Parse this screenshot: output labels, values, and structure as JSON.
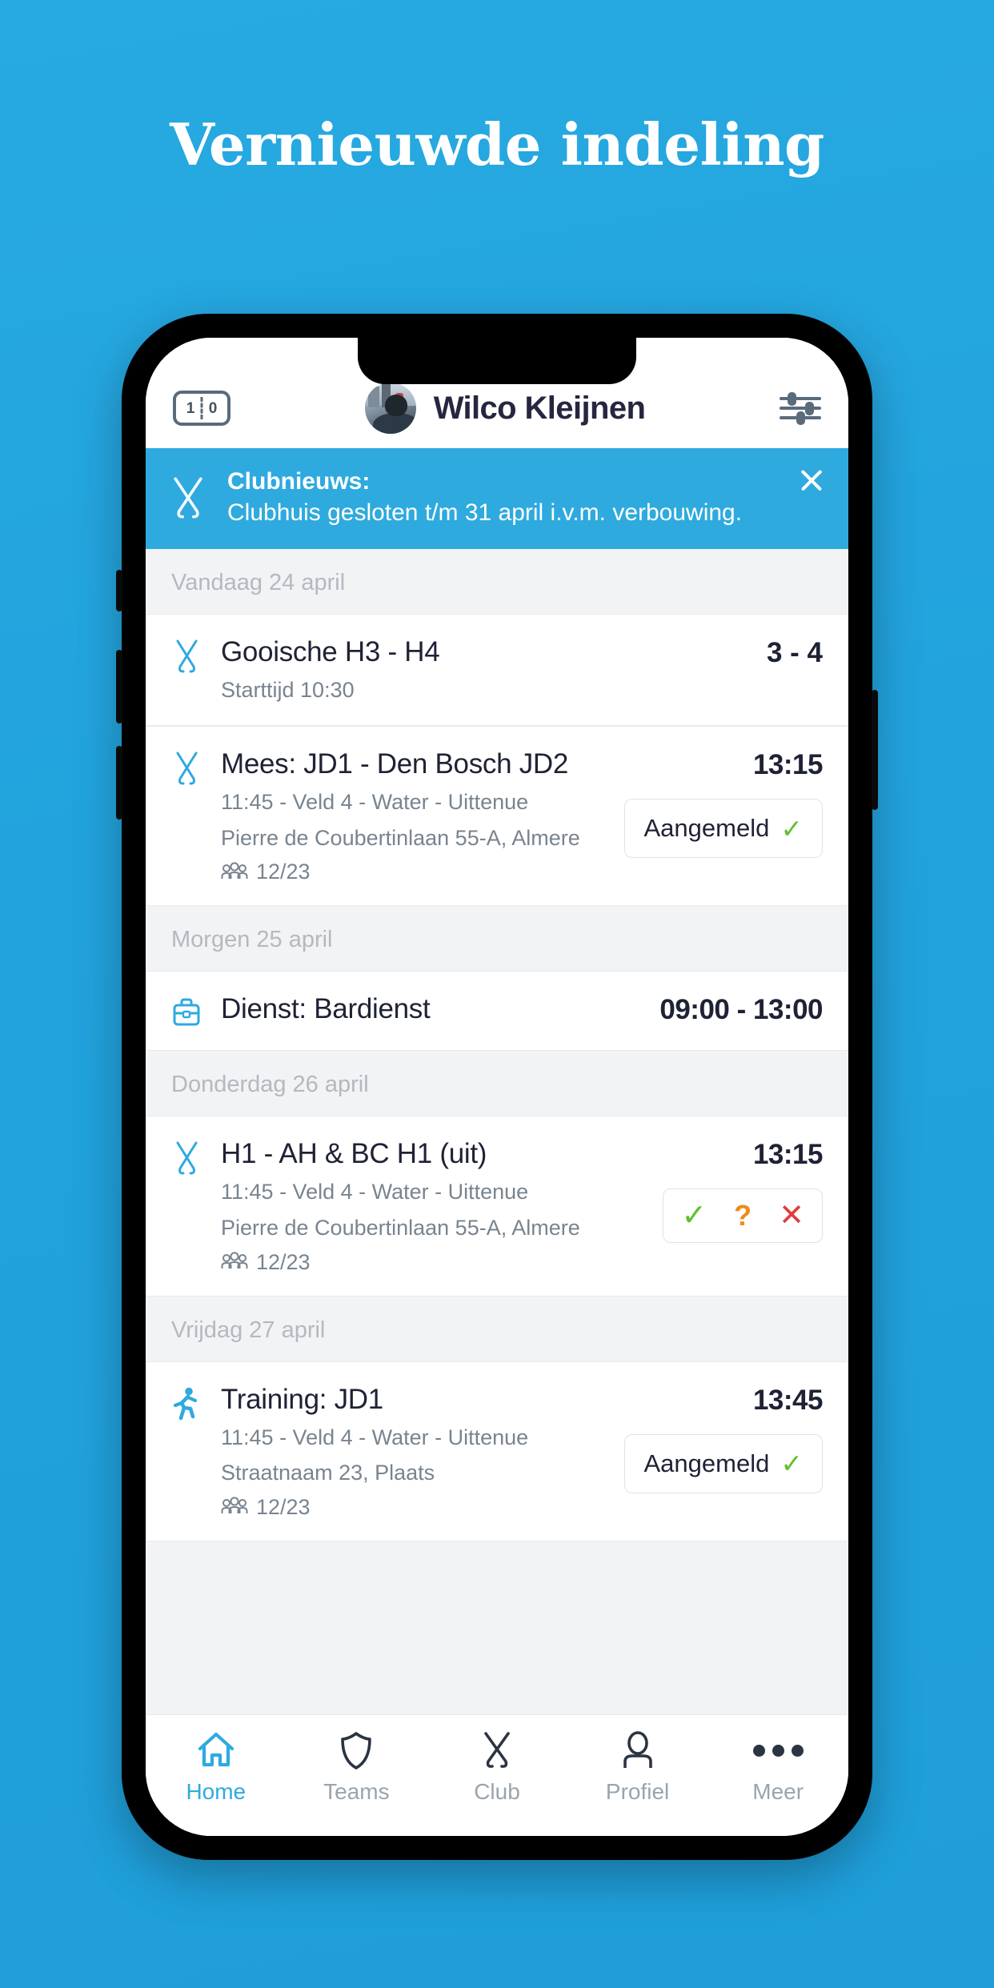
{
  "page": {
    "headline": "Vernieuwde indeling",
    "background_color": "#27a9e1"
  },
  "app_header": {
    "scoreboard_icon": "scoreboard-icon",
    "score_left": "1",
    "score_right": "0",
    "avatar": "user-avatar",
    "user_name": "Wilco Kleijnen",
    "settings_icon": "sliders-icon"
  },
  "banner": {
    "icon": "hockey-sticks-icon",
    "title": "Clubnieuws:",
    "message": "Clubhuis gesloten t/m 31 april i.v.m. verbouwing.",
    "close_icon": "close-icon",
    "background_color": "#2eaadf"
  },
  "sections": [
    {
      "day_label": "Vandaag 24 april",
      "items": [
        {
          "icon": "hockey-sticks-icon",
          "title": "Gooische H3 - H4",
          "line1": "Starttijd 10:30",
          "line2": "",
          "attendance": "",
          "right_value": "3 - 4",
          "right_kind": "score",
          "action": "none",
          "action_label": ""
        },
        {
          "icon": "hockey-sticks-icon",
          "title": "Mees: JD1 - Den Bosch JD2",
          "line1": "11:45 - Veld 4 - Water - Uittenue",
          "line2": "Pierre de Coubertinlaan 55-A, Almere",
          "attendance": "12/23",
          "right_value": "13:15",
          "right_kind": "time",
          "action": "pill",
          "action_label": "Aangemeld"
        }
      ]
    },
    {
      "day_label": "Morgen 25 april",
      "items": [
        {
          "icon": "briefcase-icon",
          "title": "Dienst: Bardienst",
          "line1": "",
          "line2": "",
          "attendance": "",
          "right_value": "09:00 - 13:00",
          "right_kind": "time",
          "action": "none",
          "action_label": ""
        }
      ]
    },
    {
      "day_label": "Donderdag 26 april",
      "items": [
        {
          "icon": "hockey-sticks-icon",
          "title": "H1 - AH & BC H1 (uit)",
          "line1": "11:45 - Veld 4 - Water - Uittenue",
          "line2": "Pierre de Coubertinlaan 55-A, Almere",
          "attendance": "12/23",
          "right_value": "13:15",
          "right_kind": "time",
          "action": "rsvp",
          "action_label": ""
        }
      ]
    },
    {
      "day_label": "Vrijdag 27 april",
      "items": [
        {
          "icon": "running-icon",
          "title": "Training: JD1",
          "line1": "11:45 - Veld 4 - Water - Uittenue",
          "line2": "Straatnaam 23, Plaats",
          "attendance": "12/23",
          "right_value": "13:45",
          "right_kind": "time",
          "action": "pill",
          "action_label": "Aangemeld"
        }
      ]
    }
  ],
  "rsvp": {
    "yes_icon": "check-icon",
    "maybe_icon": "question-mark-icon",
    "no_icon": "cross-icon",
    "yes_color": "#62c030",
    "maybe_color": "#f08a1b",
    "no_color": "#e23b3b"
  },
  "tabbar": {
    "active_color": "#2eaadf",
    "inactive_color": "#9aa4ae",
    "items": [
      {
        "label": "Home",
        "icon": "home-icon",
        "active": true
      },
      {
        "label": "Teams",
        "icon": "shield-icon",
        "active": false
      },
      {
        "label": "Club",
        "icon": "hockey-sticks-icon",
        "active": false
      },
      {
        "label": "Profiel",
        "icon": "person-icon",
        "active": false
      },
      {
        "label": "Meer",
        "icon": "ellipsis-icon",
        "active": false
      }
    ]
  }
}
